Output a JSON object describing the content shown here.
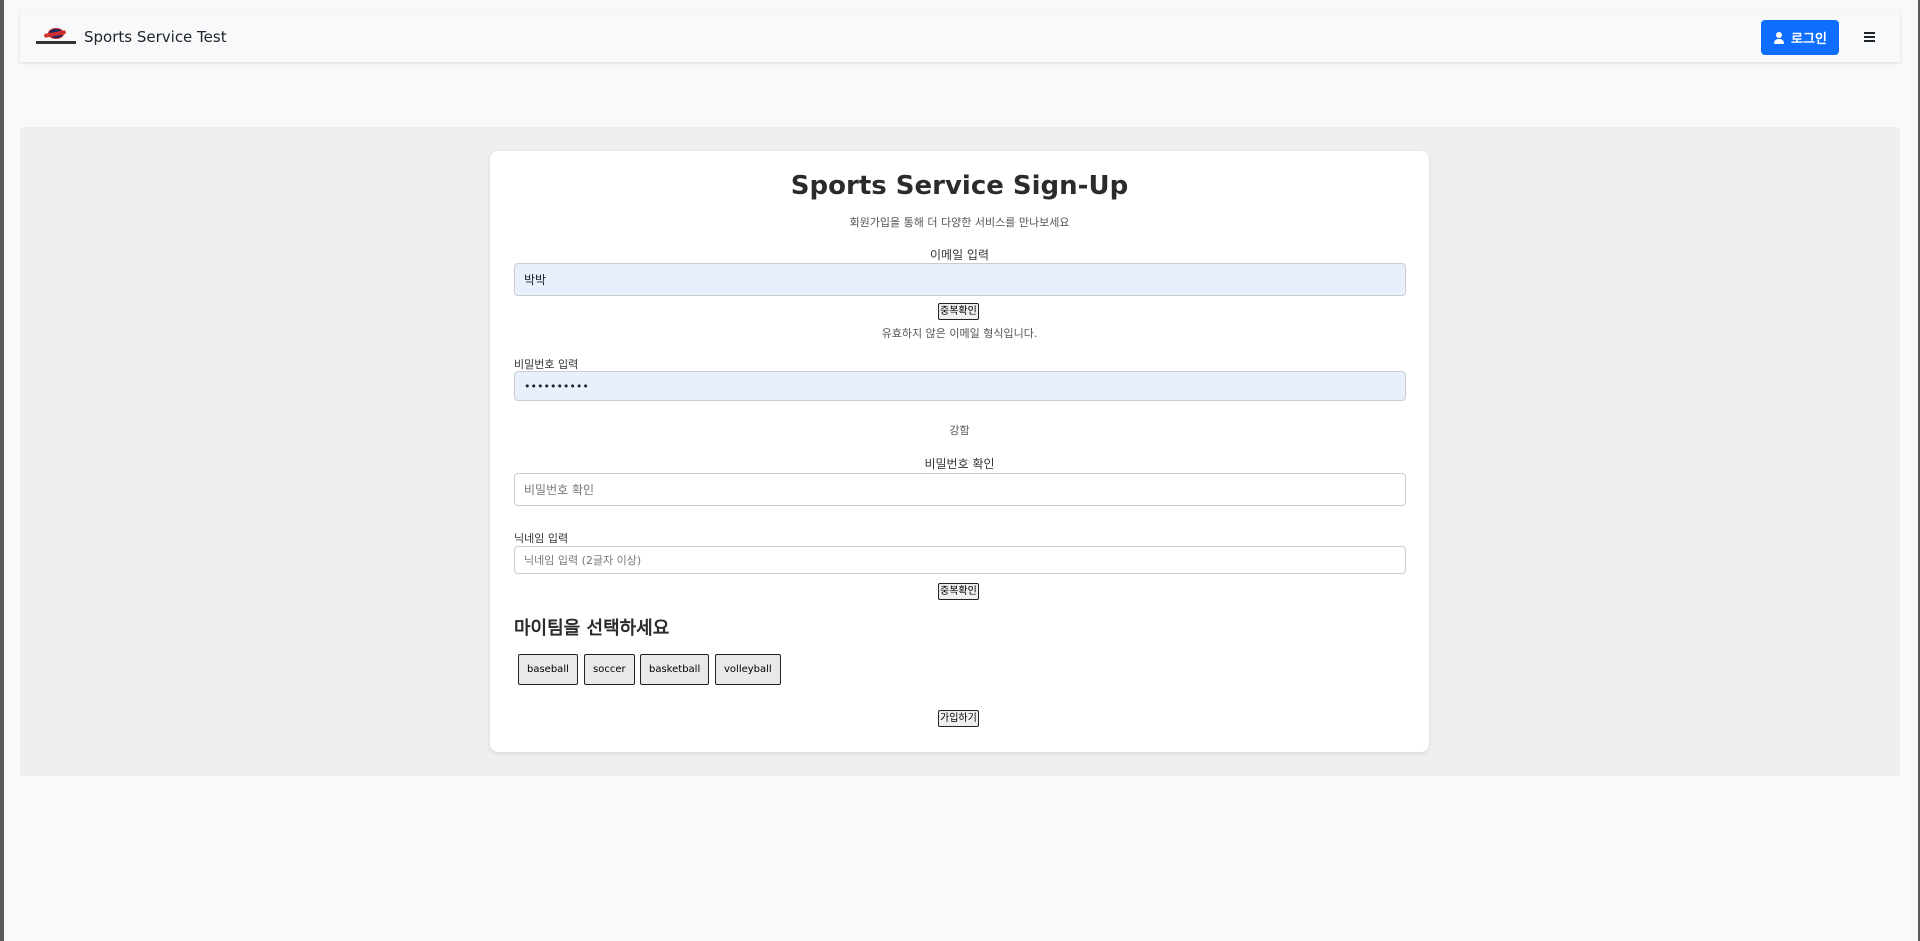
{
  "navbar": {
    "brand_title": "Sports Service Test",
    "login_label": "로그인"
  },
  "signup": {
    "title": "Sports Service Sign-Up",
    "subtitle": "회원가입을 통해 더 다양한 서비스를 만나보세요",
    "email": {
      "label": "이메일 입력",
      "value": "박박",
      "check_button": "중복확인",
      "error_message": "유효하지 않은 이메일 형식입니다."
    },
    "password": {
      "label": "비밀번호 입력",
      "value": "••••••••••",
      "strength": "강함"
    },
    "password_confirm": {
      "label": "비밀번호 확인",
      "placeholder": "비밀번호 확인",
      "value": ""
    },
    "nickname": {
      "label": "닉네임 입력",
      "placeholder": "닉네임 입력 (2글자 이상)",
      "value": "",
      "check_button": "중복확인"
    },
    "team": {
      "heading": "마이팀을 선택하세요",
      "options": [
        "baseball",
        "soccer",
        "basketball",
        "volleyball"
      ]
    },
    "submit_label": "가입하기"
  },
  "colors": {
    "primary": "#0d6efd",
    "page_bg": "#f8f9fa",
    "band_bg": "#efefef",
    "autofill_bg": "#e8f0fe"
  }
}
